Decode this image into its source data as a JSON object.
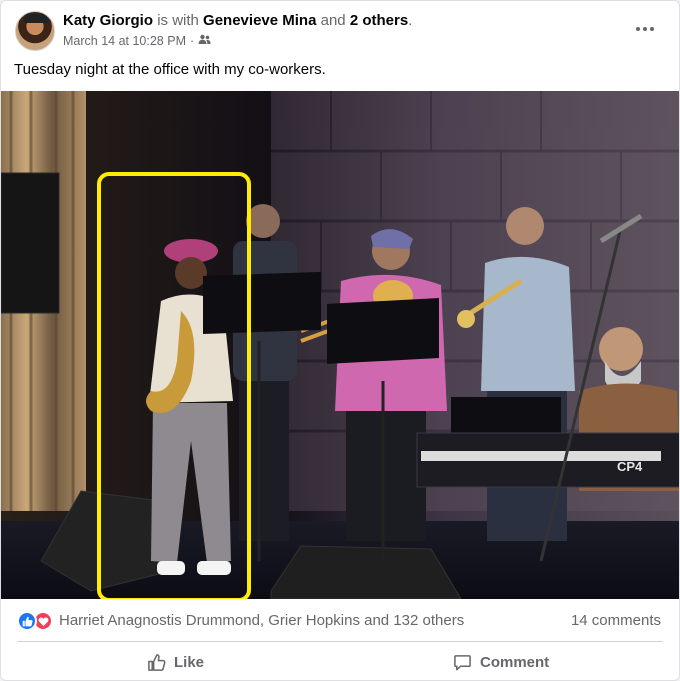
{
  "post": {
    "author": "Katy Giorgio",
    "with_text": "is with",
    "tagged_name": "Genevieve Mina",
    "and_text": "and",
    "others_text": "2 others",
    "end_punct": ".",
    "timestamp": "March 14 at 10:28 PM",
    "separator": "·",
    "audience_icon": "friends-icon",
    "caption": "Tuesday night at the office with my co-workers.",
    "more_icon": "more-options-icon"
  },
  "reactions": {
    "icons": [
      "like-reaction-icon",
      "love-reaction-icon"
    ],
    "summary": "Harriet Anagnostis Drummond, Grier Hopkins and 132 others",
    "comments": "14 comments"
  },
  "actions": {
    "like_label": "Like",
    "comment_label": "Comment"
  },
  "colors": {
    "highlight_box": "#ffec00",
    "like_blue": "#1877f2",
    "love_red": "#f33e58"
  },
  "keyboard_label": "CP4"
}
